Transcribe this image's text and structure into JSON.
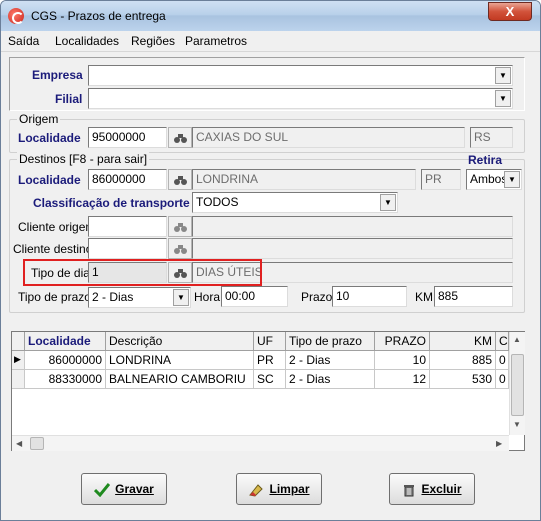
{
  "window": {
    "title": "CGS - Prazos de entrega",
    "close_label": "X"
  },
  "menu": [
    "Saída",
    "Localidades",
    "Regiões",
    "Parametros"
  ],
  "empresa": {
    "label": "Empresa",
    "value": ""
  },
  "filial": {
    "label": "Filial",
    "value": ""
  },
  "origem": {
    "legend": "Origem",
    "localidade_label": "Localidade",
    "codigo": "95000000",
    "cidade": "CAXIAS DO SUL",
    "uf": "RS"
  },
  "destinos": {
    "legend": "Destinos  [F8 - para sair]",
    "localidade_label": "Localidade",
    "codigo": "86000000",
    "cidade": "LONDRINA",
    "uf": "PR",
    "retira_label": "Retira",
    "retira_value": "Ambos",
    "classificacao_label": "Classificação de transporte",
    "classificacao_value": "TODOS",
    "cliente_origem_label": "Cliente origem",
    "cliente_origem_value": "",
    "cliente_destino_label": "Cliente destino",
    "cliente_destino_value": "",
    "tipo_dia_label": "Tipo de dia",
    "tipo_dia_codigo": "1",
    "tipo_dia_desc": "DIAS ÚTEIS",
    "tipo_prazo_label": "Tipo de prazo",
    "tipo_prazo_value": "2 - Dias",
    "hora_label": "Hora",
    "hora_value": "00:00",
    "prazo_label": "Prazo",
    "prazo_value": "10",
    "km_label": "KM",
    "km_value": "885"
  },
  "table": {
    "columns": [
      "Localidade",
      "Descrição",
      "UF",
      "Tipo de prazo",
      "PRAZO",
      "KM",
      "Clier"
    ],
    "rows": [
      [
        "86000000",
        "LONDRINA",
        "PR",
        "2 - Dias",
        "10",
        "885",
        "0"
      ],
      [
        "88330000",
        "BALNEARIO CAMBORIU",
        "SC",
        "2 - Dias",
        "12",
        "530",
        "0"
      ]
    ]
  },
  "buttons": {
    "gravar": "Gravar",
    "limpar": "Limpar",
    "excluir": "Excluir"
  },
  "colors": {
    "label_blue": "#1b1b7a",
    "highlight_red": "#e02020"
  }
}
